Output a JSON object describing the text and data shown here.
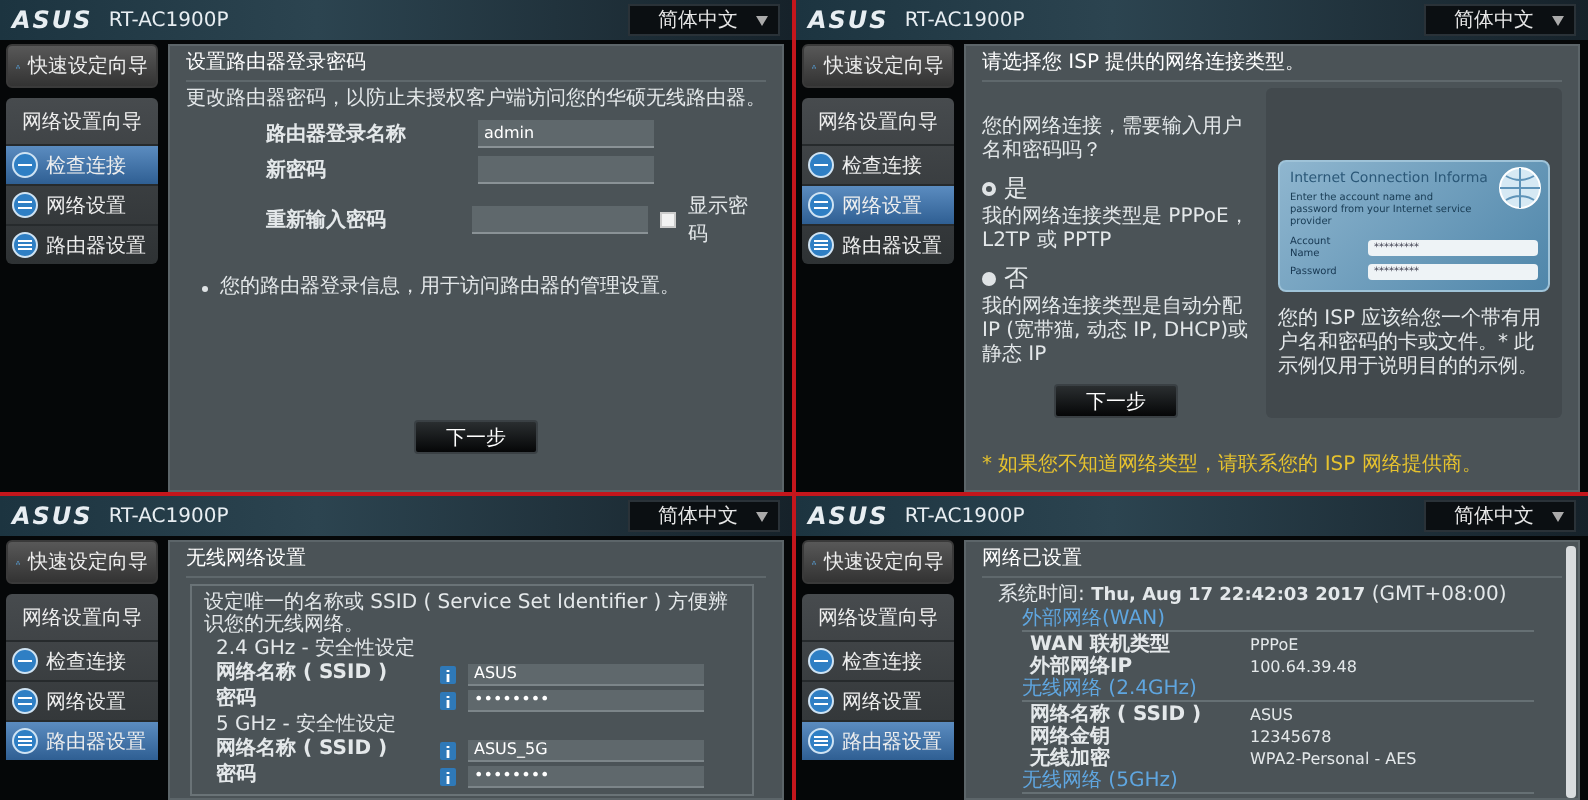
{
  "windows": [
    {
      "brand": "ASUS",
      "model": "RT-AC1900P",
      "language": "简体中文",
      "quick_setup": "快速设定向导",
      "wizard_title": "网络设置向导",
      "steps": [
        {
          "label": "检查连接",
          "selected": true
        },
        {
          "label": "网络设置",
          "selected": false
        },
        {
          "label": "路由器设置",
          "selected": false
        }
      ],
      "content": {
        "kind": "login",
        "title": "设置路由器登录密码",
        "description": "更改路由器密码，以防止未授权客户端访问您的华硕无线路由器。",
        "fields": [
          {
            "label": "路由器登录名称",
            "value": "admin"
          },
          {
            "label": "新密码"
          },
          {
            "label": "重新输入密码"
          }
        ],
        "show_password": {
          "label": "显示密码",
          "checked": false
        },
        "note": "您的路由器登录信息，用于访问路由器的管理设置。",
        "button": "下一步"
      }
    },
    {
      "brand": "ASUS",
      "model": "RT-AC1900P",
      "language": "简体中文",
      "quick_setup": "快速设定向导",
      "wizard_title": "网络设置向导",
      "steps": [
        {
          "label": "检查连接",
          "selected": false
        },
        {
          "label": "网络设置",
          "selected": true
        },
        {
          "label": "路由器设置",
          "selected": false
        }
      ],
      "content": {
        "kind": "isp",
        "title": "请选择您 ISP 提供的网络连接类型。",
        "question": "您的网络连接，需要输入用户名和密码吗？",
        "options": [
          {
            "label": "是",
            "description": "我的网络连接类型是 PPPoE，L2TP 或 PPTP",
            "selected": true
          },
          {
            "label": "否",
            "description": "我的网络连接类型是自动分配 IP (宽带猫, 动态 IP, DHCP)或静态 IP",
            "selected": false
          }
        ],
        "button": "下一步",
        "illustration": {
          "title": "Internet Connection Informa",
          "subtitle": "Enter the account name and password from your Internet service provider",
          "fields": [
            {
              "label": "Account Name",
              "value": "*********"
            },
            {
              "label": "Password",
              "value": "*********"
            }
          ]
        },
        "caption": "您的 ISP 应该给您一个带有用户名和密码的卡或文件。* 此示例仅用于说明目的的示例。",
        "footnote": "* 如果您不知道网络类型，请联系您的 ISP 网络提供商。"
      }
    },
    {
      "brand": "ASUS",
      "model": "RT-AC1900P",
      "language": "简体中文",
      "quick_setup": "快速设定向导",
      "wizard_title": "网络设置向导",
      "steps": [
        {
          "label": "检查连接",
          "selected": false
        },
        {
          "label": "网络设置",
          "selected": false
        },
        {
          "label": "路由器设置",
          "selected": true
        }
      ],
      "content": {
        "kind": "wireless",
        "title": "无线网络设置",
        "description": "设定唯一的名称或 SSID ( Service Set Identifier ) 方便辨识您的无线网络。",
        "bands": [
          {
            "heading": "2.4 GHz - 安全性设定",
            "fields": [
              {
                "label": "网络名称 ( SSID )",
                "value": "ASUS"
              },
              {
                "label": "密码",
                "value": "••••••••"
              }
            ]
          },
          {
            "heading": "5 GHz - 安全性设定",
            "fields": [
              {
                "label": "网络名称 ( SSID )",
                "value": "ASUS_5G"
              },
              {
                "label": "密码",
                "value": "••••••••"
              }
            ]
          }
        ]
      }
    },
    {
      "brand": "ASUS",
      "model": "RT-AC1900P",
      "language": "简体中文",
      "quick_setup": "快速设定向导",
      "wizard_title": "网络设置向导",
      "steps": [
        {
          "label": "检查连接",
          "selected": false
        },
        {
          "label": "网络设置",
          "selected": false
        },
        {
          "label": "路由器设置",
          "selected": true
        }
      ],
      "content": {
        "kind": "summary",
        "title": "网络已设置",
        "time": "系统时间: **Thu, Aug 17 22:42:03 2017** (GMT+08:00)",
        "sections": [
          {
            "heading": "外部网络(WAN)",
            "rows": [
              {
                "label": "WAN 联机类型",
                "value": "PPPoE"
              },
              {
                "label": "外部网络IP",
                "value": "100.64.39.48"
              }
            ]
          },
          {
            "heading": "无线网络 (2.4GHz)",
            "rows": [
              {
                "label": "网络名称 ( SSID )",
                "value": "ASUS"
              },
              {
                "label": "网络金钥",
                "value": "12345678"
              },
              {
                "label": "无线加密",
                "value": "WPA2-Personal - AES"
              }
            ]
          },
          {
            "heading": "无线网络 (5GHz)"
          }
        ]
      }
    }
  ]
}
